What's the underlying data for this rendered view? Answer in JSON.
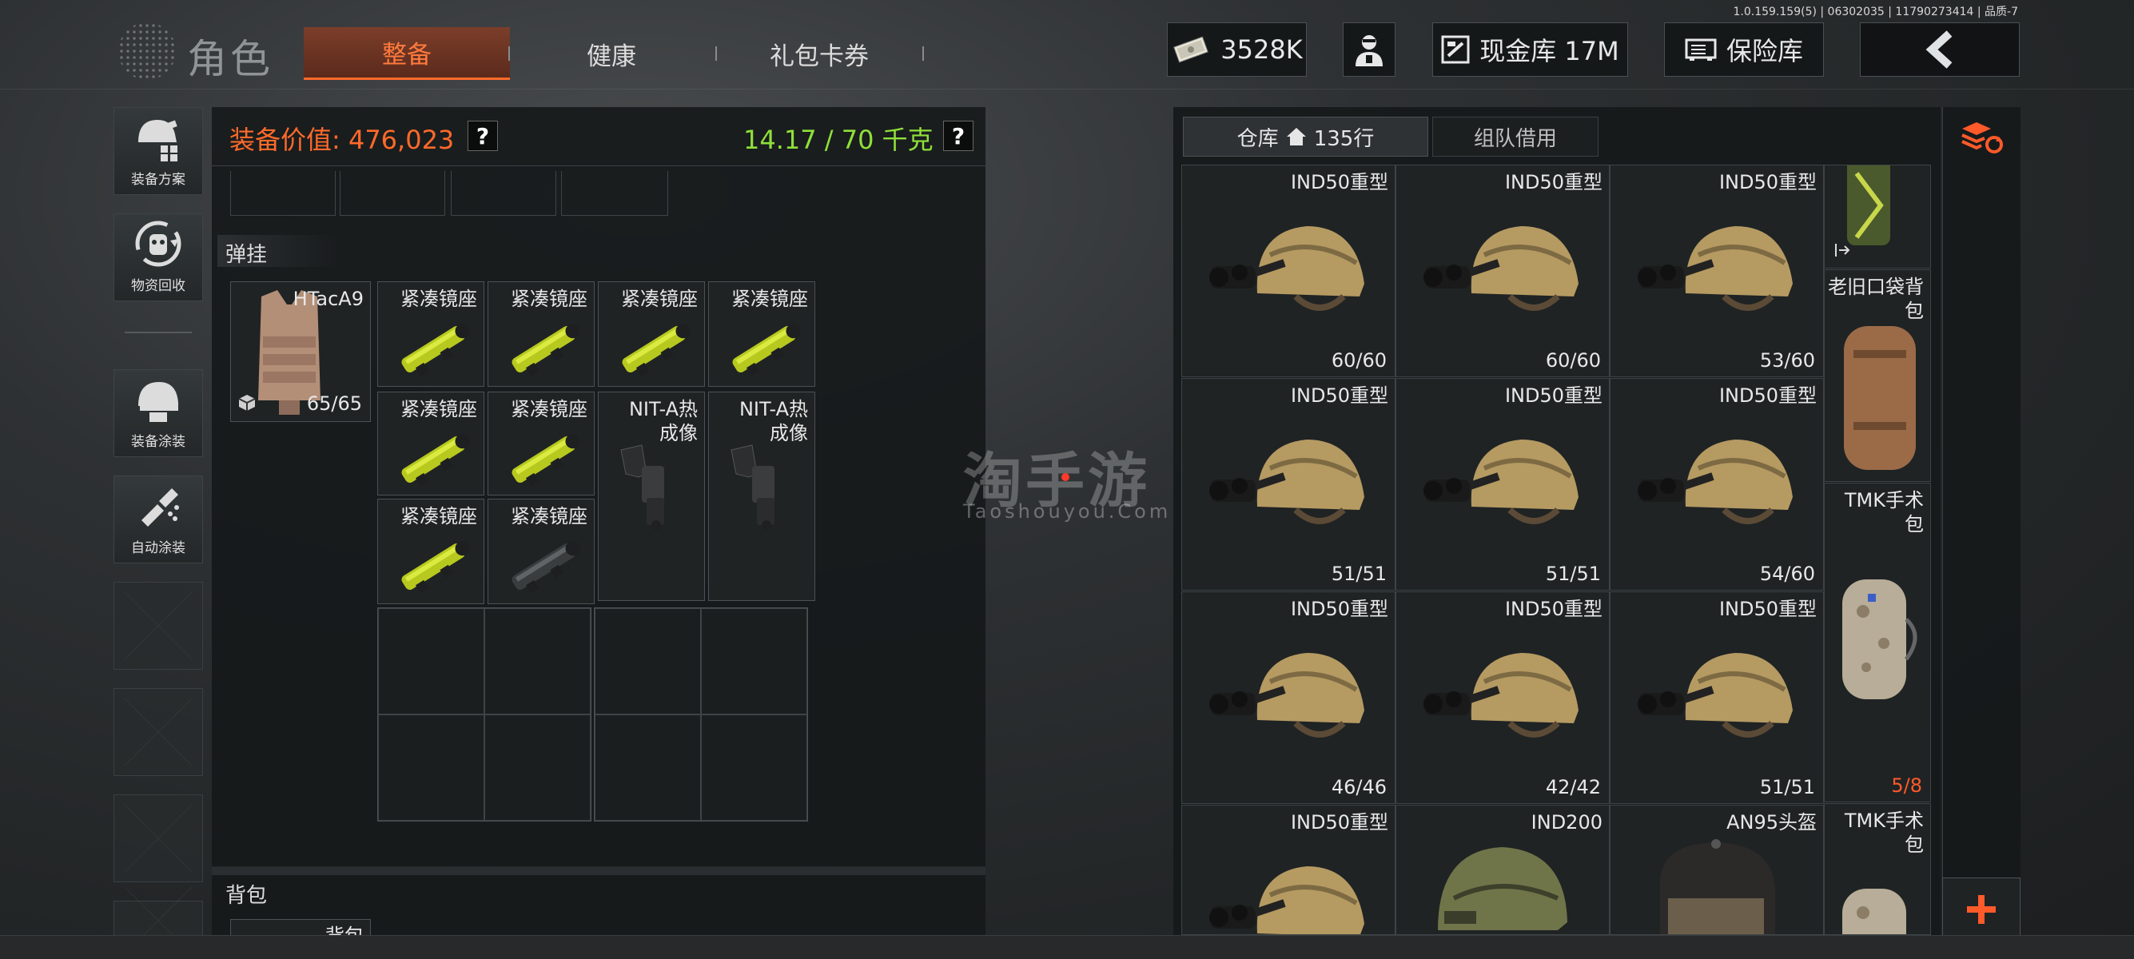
{
  "version_text": "1.0.159.159(5) | 06302035 | 11790273414 | 品质-7",
  "header": {
    "title": "角色",
    "tabs": [
      "整备",
      "健康",
      "礼包卡券"
    ],
    "active_tab": "整备",
    "currency_value": "3528K",
    "cash_vault": "现金库 17M",
    "insurance": "保险库"
  },
  "sidebar": {
    "items": [
      {
        "label": "装备方案",
        "icon": "helmet-grid-icon"
      },
      {
        "label": "物资回收",
        "icon": "recycle-icon"
      },
      {
        "label": "装备涂装",
        "icon": "helmet-paint-icon"
      },
      {
        "label": "自动涂装",
        "icon": "spray-icon"
      }
    ]
  },
  "loadout": {
    "value_label": "装备价值: 476,023",
    "weight_label": "14.17 / 70 千克",
    "help": "?",
    "section_rig": "弹挂",
    "section_backpack": "背包",
    "backpack_item": "背包",
    "vest": {
      "name": "HTacA9",
      "count": "65/65"
    },
    "rig_items": [
      {
        "name": "紧凑镜座",
        "kind": "yellow"
      },
      {
        "name": "紧凑镜座",
        "kind": "yellow"
      },
      {
        "name": "紧凑镜座",
        "kind": "yellow"
      },
      {
        "name": "紧凑镜座",
        "kind": "yellow"
      },
      {
        "name": "紧凑镜座",
        "kind": "yellow"
      },
      {
        "name": "紧凑镜座",
        "kind": "yellow"
      },
      {
        "name": "NIT-A热\n成像",
        "kind": "thermal"
      },
      {
        "name": "NIT-A热\n成像",
        "kind": "thermal"
      },
      {
        "name": "紧凑镜座",
        "kind": "yellow"
      },
      {
        "name": "紧凑镜座",
        "kind": "dark"
      }
    ]
  },
  "warehouse": {
    "tab_storage": "仓库",
    "rows": "135行",
    "tab_team": "组队借用",
    "grid": [
      {
        "name": "IND50重型",
        "count": "60/60",
        "type": "nvg-helmet"
      },
      {
        "name": "IND50重型",
        "count": "60/60",
        "type": "nvg-helmet"
      },
      {
        "name": "IND50重型",
        "count": "53/60",
        "type": "nvg-helmet"
      },
      {
        "name": "IND50重型",
        "count": "51/51",
        "type": "nvg-helmet"
      },
      {
        "name": "IND50重型",
        "count": "51/51",
        "type": "nvg-helmet"
      },
      {
        "name": "IND50重型",
        "count": "54/60",
        "type": "nvg-helmet"
      },
      {
        "name": "IND50重型",
        "count": "46/46",
        "type": "nvg-helmet"
      },
      {
        "name": "IND50重型",
        "count": "42/42",
        "type": "nvg-helmet"
      },
      {
        "name": "IND50重型",
        "count": "51/51",
        "type": "nvg-helmet"
      },
      {
        "name": "IND50重型",
        "count": "",
        "type": "nvg-helmet"
      },
      {
        "name": "IND200",
        "count": "",
        "type": "green-helmet"
      },
      {
        "name": "AN95头盔",
        "count": "",
        "type": "dark-helmet"
      }
    ],
    "side_items": [
      {
        "name": "",
        "count": ""
      },
      {
        "name": "老旧口袋背\n包",
        "count": ""
      },
      {
        "name": "TMK手术\n包",
        "count": "5/8"
      },
      {
        "name": "TMK手术\n包",
        "count": ""
      }
    ]
  },
  "watermark": {
    "brand": "淘手游",
    "url": "Taoshouyou.Com"
  },
  "colors": {
    "accent_orange": "#ff6a2a",
    "value_orange": "#ff6a2a",
    "weight_green": "#8fe03a",
    "count_red": "#ff5a2a"
  }
}
